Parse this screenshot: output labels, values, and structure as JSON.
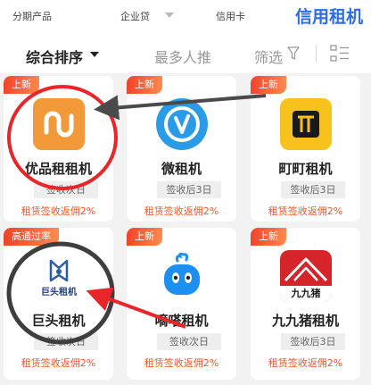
{
  "top_tabs": [
    {
      "label": "分期产品"
    },
    {
      "label": "企业贷"
    },
    {
      "label": "信用卡"
    },
    {
      "label": "信用租机"
    }
  ],
  "sort_bar": {
    "primary": "综合排序",
    "popular": "最多人推",
    "filter": "筛选"
  },
  "products": [
    {
      "badge": "上新",
      "name": "优品租租机",
      "tag": "签收次日",
      "rebate": "租赁签收返佣2%",
      "logo": "upin-logo"
    },
    {
      "badge": "上新",
      "name": "微租机",
      "tag": "签收后3日",
      "rebate": "租赁签收返佣2%",
      "logo": "v-circle-logo"
    },
    {
      "badge": "上新",
      "name": "町町租机",
      "tag": "签收后3日",
      "rebate": "租赁签收返佣2%",
      "logo": "dingding-logo"
    },
    {
      "badge": "高通过率",
      "name": "巨头租机",
      "tag": "签收次日",
      "rebate": "租赁签收返佣2%",
      "logo": "jutou-logo",
      "logo_text": "巨头租机"
    },
    {
      "badge": "上新",
      "name": "嘀嗒租机",
      "tag": "签收次日",
      "rebate": "租赁签收返佣2%",
      "logo": "blue-mascot-logo"
    },
    {
      "badge": "上新",
      "name": "九九猪租机",
      "tag": "签收后3日",
      "rebate": "租赁签收返佣2%",
      "logo": "jiujiuzhu-logo",
      "logo_text": "九九猪"
    }
  ],
  "colors": {
    "accent_blue": "#2b6de8",
    "badge_red": "#f0432a",
    "rebate_orange": "#ef5a2b",
    "annotation_red": "#e8262a",
    "annotation_dark": "#4a4a4a"
  }
}
